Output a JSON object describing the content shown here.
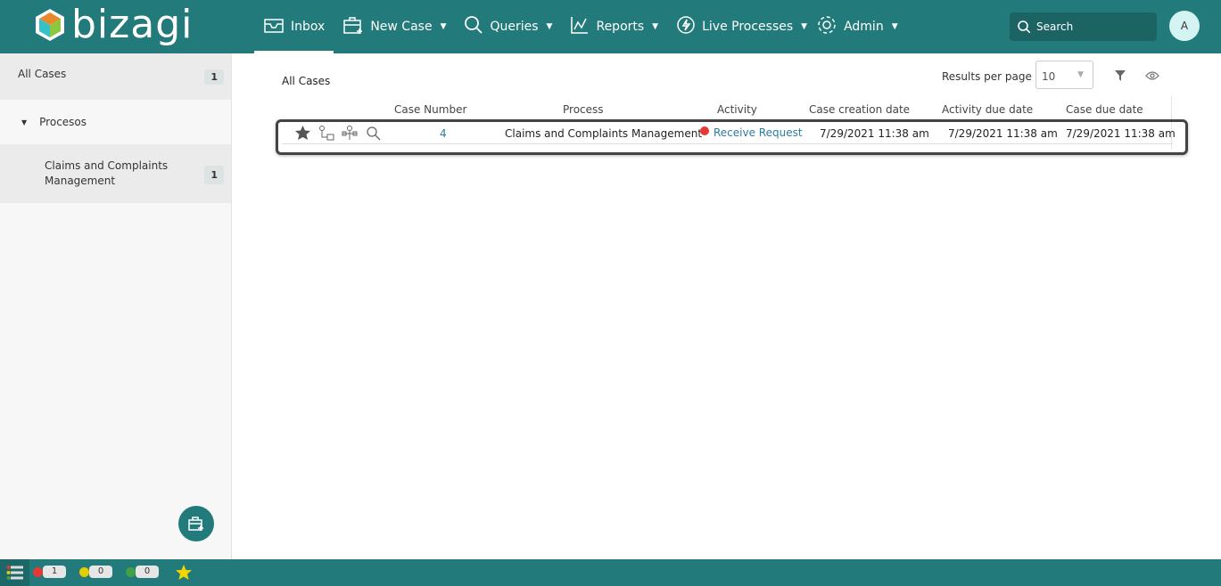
{
  "header": {
    "logo": "bizagi",
    "nav": [
      {
        "label": "Inbox",
        "icon": "inbox-icon",
        "active": true
      },
      {
        "label": "New Case",
        "icon": "new-case-icon"
      },
      {
        "label": "Queries",
        "icon": "search-icon"
      },
      {
        "label": "Reports",
        "icon": "chart-icon"
      },
      {
        "label": "Live Processes",
        "icon": "lightning-icon"
      },
      {
        "label": "Admin",
        "icon": "gear-icon"
      }
    ],
    "search_placeholder": "Search",
    "avatar": "A"
  },
  "sidebar": {
    "all_cases": {
      "label": "All Cases",
      "count": "1"
    },
    "group": "Procesos",
    "items": [
      {
        "label": "Claims and Complaints Management",
        "count": "1"
      }
    ]
  },
  "main": {
    "title": "All Cases",
    "results_per_page_label": "Results per page",
    "results_per_page": "10",
    "columns": [
      "Case Number",
      "Process",
      "Activity",
      "Case creation date",
      "Activity due date",
      "Case due date"
    ],
    "rows": [
      {
        "case_number": "4",
        "process": "Claims and Complaints Management",
        "activity": "Receive Request",
        "activity_status": "#e53935",
        "creation": "7/29/2021 11:38 am",
        "activity_due": "7/29/2021 11:38 am",
        "case_due": "7/29/2021 11:38 am"
      }
    ]
  },
  "footer": {
    "red": "1",
    "yellow": "0",
    "green": "0"
  },
  "colors": {
    "brand": "#227a7a",
    "red": "#e53935",
    "yellow": "#e6cc00",
    "green": "#43a047"
  }
}
